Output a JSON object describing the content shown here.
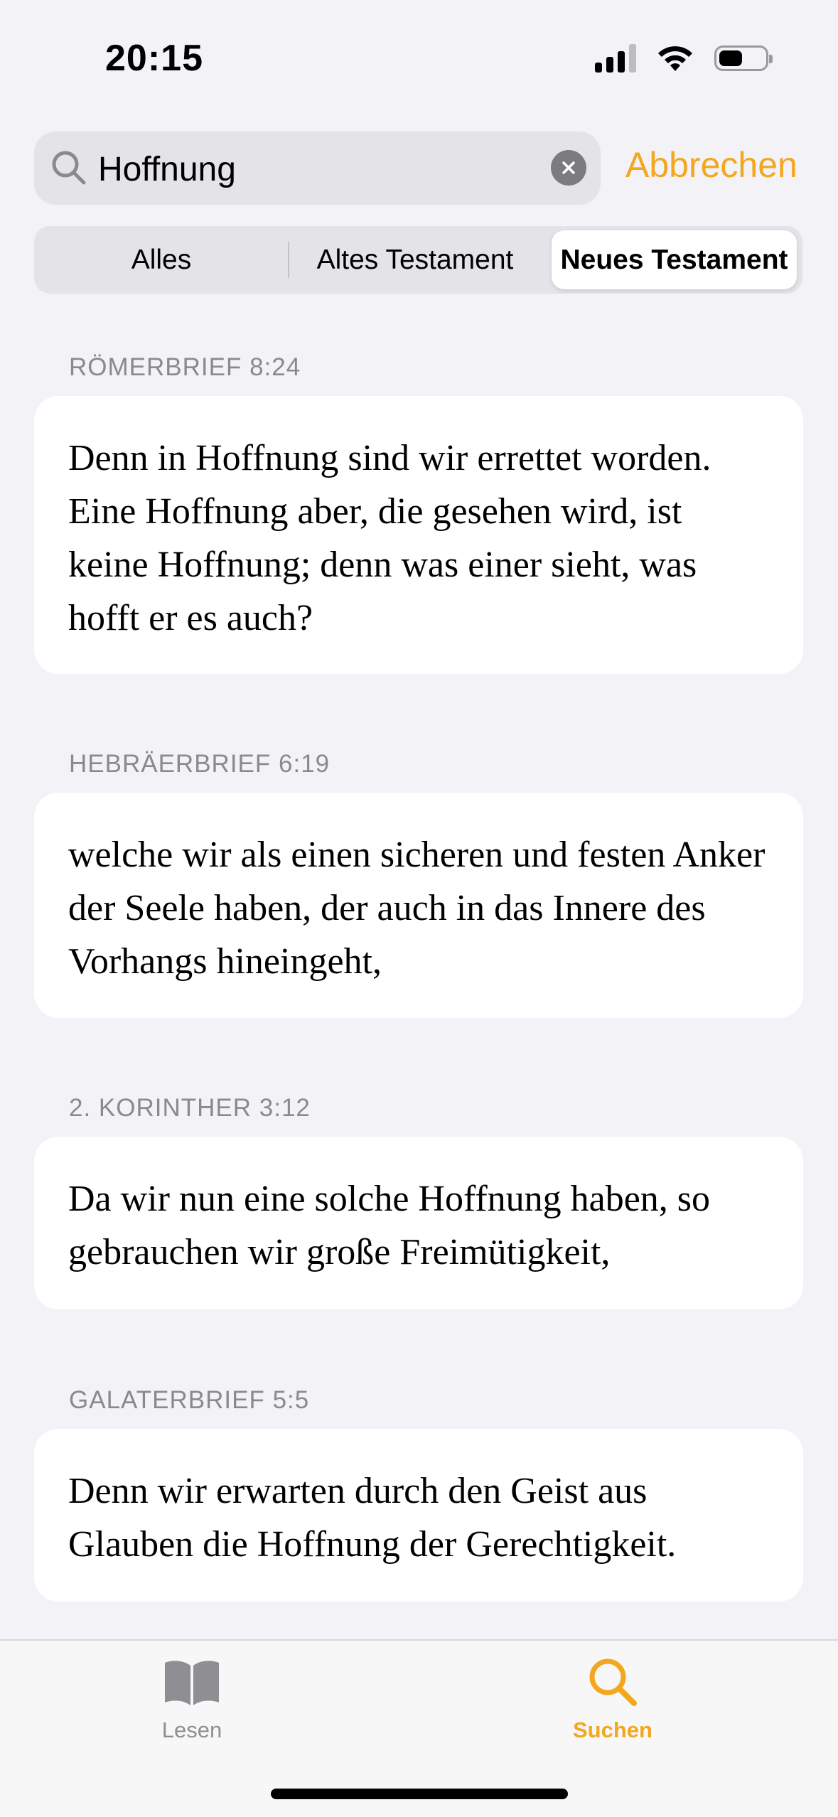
{
  "status_bar": {
    "time": "20:15"
  },
  "search": {
    "query": "Hoffnung",
    "cancel_label": "Abbrechen"
  },
  "segments": [
    {
      "label": "Alles"
    },
    {
      "label": "Altes Testament"
    },
    {
      "label": "Neues Testament",
      "selected": true
    }
  ],
  "results": [
    {
      "reference": "RÖMERBRIEF 8:24",
      "text": "Denn in Hoffnung sind wir errettet worden. Eine Hoffnung aber, die gesehen wird, ist keine Hoffnung; denn was einer sieht, was hofft er es auch?"
    },
    {
      "reference": "HEBRÄERBRIEF 6:19",
      "text": "welche wir als einen sicheren und festen Anker der Seele haben, der auch in das Innere des Vorhangs hineingeht,"
    },
    {
      "reference": "2. KORINTHER 3:12",
      "text": "Da wir nun eine solche Hoffnung haben, so gebrauchen wir große Freimütigkeit,"
    },
    {
      "reference": "GALATERBRIEF 5:5",
      "text": "Denn wir erwarten durch den Geist aus Glauben die Hoffnung der Gerechtigkeit."
    }
  ],
  "tab_bar": {
    "read_label": "Lesen",
    "search_label": "Suchen"
  },
  "colors": {
    "accent": "#F3A71E",
    "background": "#F2F2F7",
    "card": "#FFFFFF",
    "secondary_text": "#8A8A8E"
  },
  "icons": [
    "search-icon",
    "clear-icon",
    "book-icon",
    "cellular-signal-icon",
    "wifi-icon",
    "battery-icon"
  ]
}
